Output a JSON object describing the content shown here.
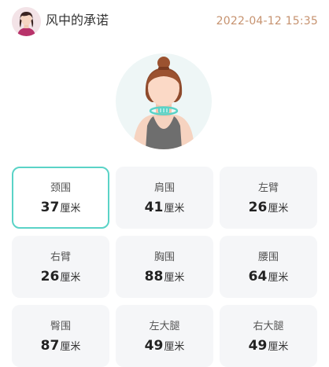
{
  "header": {
    "username": "风中的承诺",
    "timestamp": "2022-04-12 15:35"
  },
  "measurements": [
    {
      "label": "颈围",
      "value": "37",
      "unit": "厘米",
      "selected": true
    },
    {
      "label": "肩围",
      "value": "41",
      "unit": "厘米",
      "selected": false
    },
    {
      "label": "左臂",
      "value": "26",
      "unit": "厘米",
      "selected": false
    },
    {
      "label": "右臂",
      "value": "26",
      "unit": "厘米",
      "selected": false
    },
    {
      "label": "胸围",
      "value": "88",
      "unit": "厘米",
      "selected": false
    },
    {
      "label": "腰围",
      "value": "64",
      "unit": "厘米",
      "selected": false
    },
    {
      "label": "臀围",
      "value": "87",
      "unit": "厘米",
      "selected": false
    },
    {
      "label": "左大腿",
      "value": "49",
      "unit": "厘米",
      "selected": false
    },
    {
      "label": "右大腿",
      "value": "49",
      "unit": "厘米",
      "selected": false
    }
  ],
  "colors": {
    "accent": "#5ad3c7",
    "timestamp": "#c6926f",
    "card_bg": "#f5f6f8"
  }
}
